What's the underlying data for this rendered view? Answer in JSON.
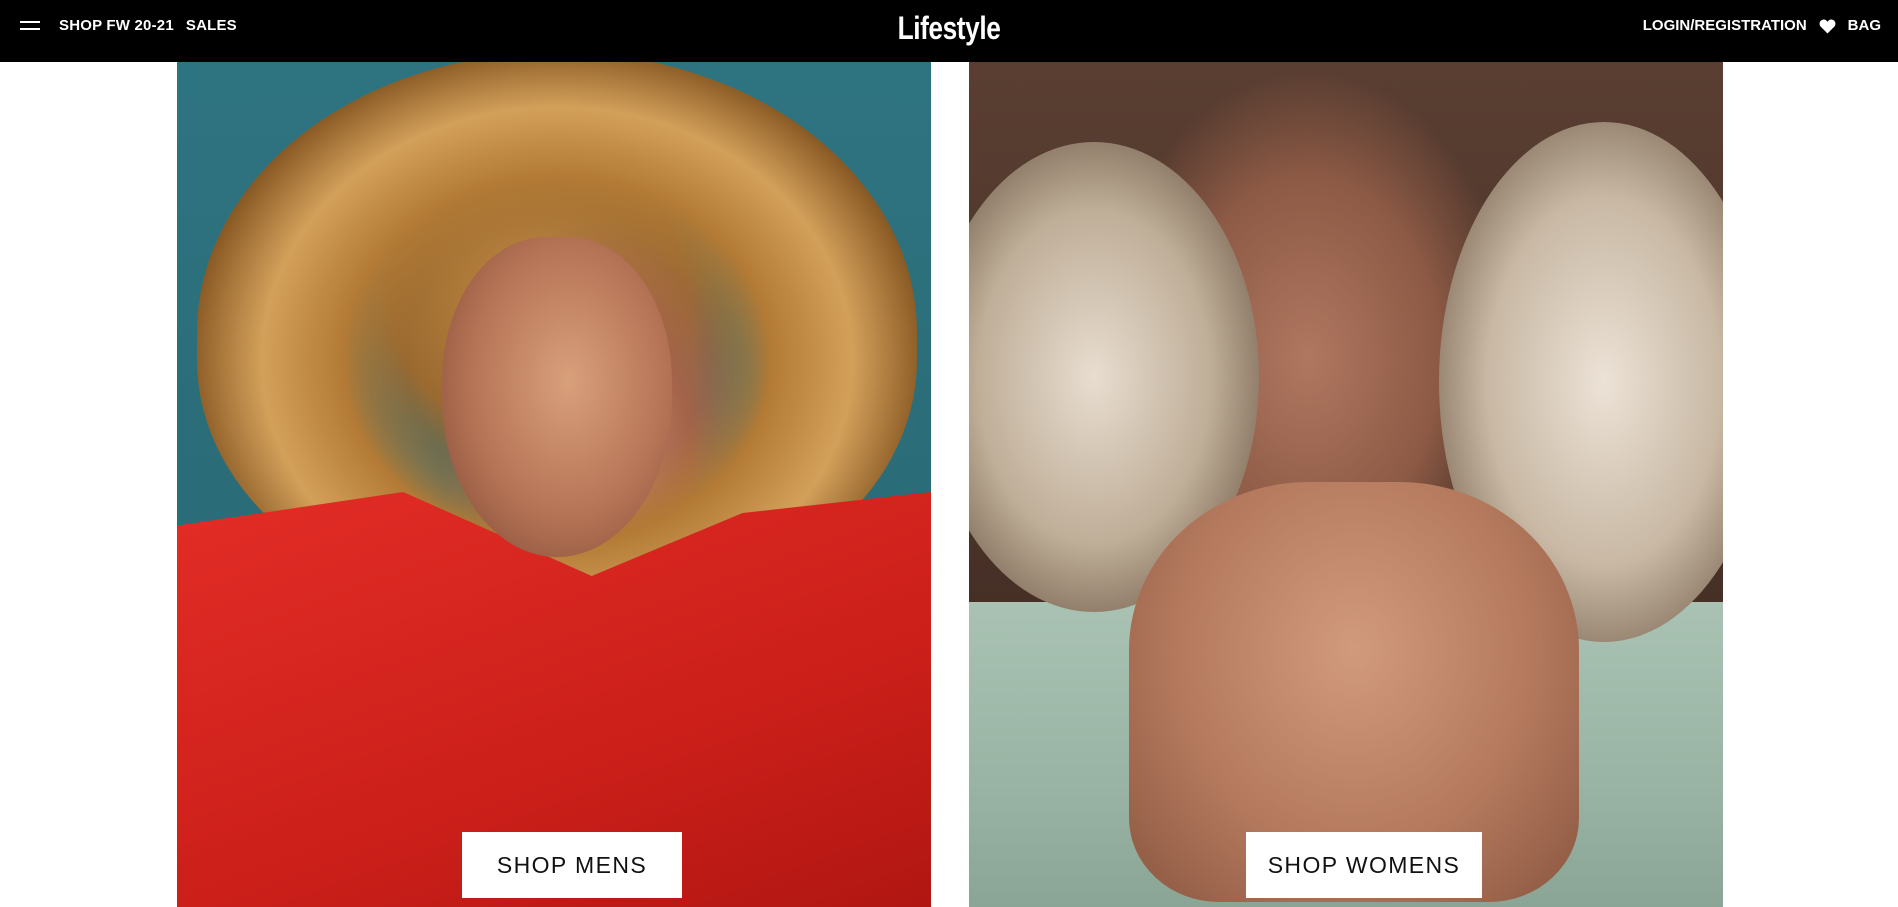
{
  "header": {
    "brand": "Lifestyle",
    "nav_left": [
      "SHOP FW 20-21",
      "SALES"
    ],
    "login_label": "LOGIN/REGISTRATION",
    "bag_label": "BAG",
    "icons": [
      "menu-icon",
      "heart-icon"
    ]
  },
  "hero": {
    "mens_button": "SHOP MENS",
    "womens_button": "SHOP WOMENS"
  },
  "colors": {
    "header_bg": "#000000",
    "header_text": "#ffffff",
    "button_bg": "#ffffff",
    "button_text": "#111111"
  }
}
